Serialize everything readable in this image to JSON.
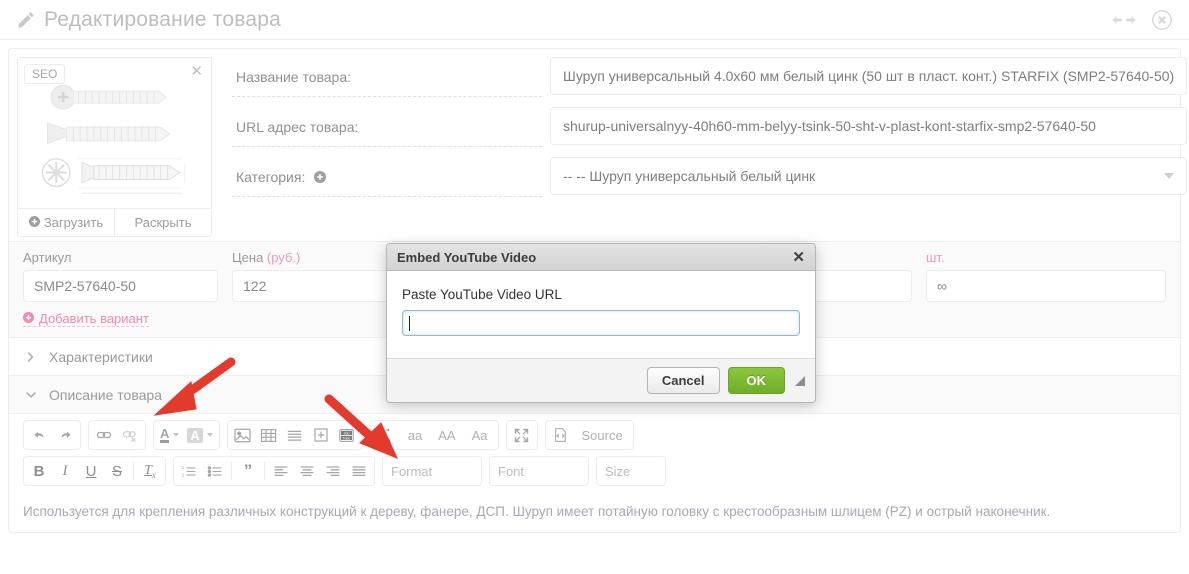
{
  "header": {
    "title": "Редактирование товара",
    "pencil_icon": "pencil-icon",
    "resize_icon": "left-right-arrows-icon",
    "close_icon": "close-circle-icon"
  },
  "image_panel": {
    "seo_badge": "SEO",
    "close_icon": "close-icon",
    "upload_label": "Загрузить",
    "expand_label": "Раскрыть",
    "upload_icon": "plus-circle-icon"
  },
  "form": {
    "rows": [
      {
        "label": "Название товара:",
        "value": "Шуруп универсальный 4.0x60 мм белый цинк (50 шт в пласт. конт.) STARFIX (SMP2-57640-50)",
        "type": "text"
      },
      {
        "label": "URL адрес товара:",
        "value": "shurup-universalnyy-40h60-mm-belyy-tsink-50-sht-v-plast-kont-starfix-smp2-57640-50",
        "type": "text"
      },
      {
        "label": "Категория:",
        "value": "-- -- Шуруп универсальный белый цинк",
        "type": "select"
      }
    ],
    "category_add_icon": "plus-circle-icon"
  },
  "variant_strip": {
    "sku_label": "Артикул",
    "sku_value": "SMP2-57640-50",
    "price_label": "Цена",
    "price_unit": "(руб.)",
    "price_value": "122",
    "qty_label": "шт.",
    "qty_value": "∞",
    "add_variant_label": "Добавить вариант",
    "add_variant_icon": "plus-circle-icon"
  },
  "accordions": [
    {
      "label": "Характеристики",
      "expanded": false,
      "icon": "chevron-right-icon"
    },
    {
      "label": "Описание товара",
      "expanded": true,
      "icon": "chevron-down-icon"
    }
  ],
  "editor": {
    "toolbar_row1": [
      {
        "group": [
          {
            "name": "undo-icon",
            "label": ""
          },
          {
            "name": "redo-icon",
            "label": ""
          }
        ]
      },
      {
        "group": [
          {
            "name": "link-icon",
            "label": ""
          },
          {
            "name": "unlink-icon",
            "label": ""
          }
        ]
      },
      {
        "group": [
          {
            "name": "text-color-icon",
            "label": "A",
            "caret": true
          },
          {
            "name": "background-color-icon",
            "label": "A",
            "caret": true
          }
        ]
      },
      {
        "group": [
          {
            "name": "image-icon",
            "label": ""
          },
          {
            "name": "table-icon",
            "label": ""
          },
          {
            "name": "horizontal-rule-icon",
            "label": ""
          },
          {
            "name": "page-break-icon",
            "label": ""
          },
          {
            "name": "youtube-icon",
            "label": ""
          }
        ]
      },
      {
        "group": [
          {
            "name": "change-case-icon",
            "label": ""
          },
          {
            "name": "lowercase-icon",
            "label": "aa"
          },
          {
            "name": "uppercase-icon",
            "label": "AA"
          },
          {
            "name": "capitalize-icon",
            "label": "Aa"
          }
        ]
      },
      {
        "group": [
          {
            "name": "maximize-icon",
            "label": ""
          }
        ]
      },
      {
        "group": [
          {
            "name": "source-icon",
            "label": "Source"
          }
        ]
      }
    ],
    "toolbar_row2": [
      {
        "group": [
          {
            "name": "bold-icon",
            "label": "B"
          },
          {
            "name": "italic-icon",
            "label": "I"
          },
          {
            "name": "underline-icon",
            "label": "U"
          },
          {
            "name": "strikethrough-icon",
            "label": "S"
          },
          {
            "name": "remove-format-icon",
            "label": "Tx"
          }
        ]
      },
      {
        "group": [
          {
            "name": "numbered-list-icon",
            "label": ""
          },
          {
            "name": "bulleted-list-icon",
            "label": ""
          },
          {
            "name": "blockquote-icon",
            "label": "”"
          },
          {
            "name": "align-left-icon",
            "label": ""
          },
          {
            "name": "align-center-icon",
            "label": ""
          },
          {
            "name": "align-right-icon",
            "label": ""
          },
          {
            "name": "justify-icon",
            "label": ""
          }
        ]
      }
    ],
    "dropdowns": [
      {
        "name": "format-dropdown",
        "label": "Format"
      },
      {
        "name": "font-dropdown",
        "label": "Font"
      },
      {
        "name": "size-dropdown",
        "label": "Size"
      }
    ],
    "content": "Используется для крепления различных конструкций к дереву, фанере, ДСП. Шуруп имеет потайную головку с крестообразным шлицем (PZ) и острый наконечник."
  },
  "modal": {
    "title": "Embed YouTube Video",
    "close_icon": "close-icon",
    "field_label": "Paste YouTube Video URL",
    "input_value": "",
    "input_placeholder": "",
    "cancel_label": "Cancel",
    "ok_label": "OK",
    "resize_grip_icon": "resize-grip-icon"
  },
  "annotations": {
    "arrow_color": "#e23b2e",
    "arrows": [
      {
        "name": "arrow-to-description-accordion"
      },
      {
        "name": "arrow-to-youtube-button"
      }
    ]
  }
}
